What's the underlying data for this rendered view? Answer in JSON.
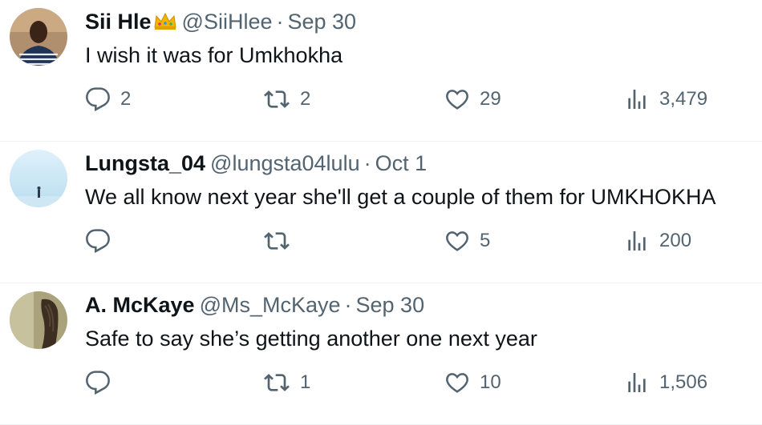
{
  "tweets": [
    {
      "name": "Sii Hle",
      "name_emoji": "crown",
      "handle": "@SiiHlee",
      "date": "Sep 30",
      "text": "I wish it was for Umkhokha",
      "replies": "2",
      "retweets": "2",
      "likes": "29",
      "views": "3,479"
    },
    {
      "name": "Lungsta_04",
      "handle": "@lungsta04lulu",
      "date": "Oct 1",
      "text": "We all know next year she'll get a couple of them for UMKHOKHA",
      "replies": "",
      "retweets": "",
      "likes": "5",
      "views": "200"
    },
    {
      "name": "A. McKaye",
      "handle": "@Ms_McKaye",
      "date": "Sep 30",
      "text": "Safe to say she’s getting another one next year",
      "replies": "",
      "retweets": "1",
      "likes": "10",
      "views": "1,506"
    }
  ],
  "icons": {
    "reply": "reply-icon",
    "retweet": "retweet-icon",
    "like": "heart-icon",
    "views": "views-icon"
  },
  "colors": {
    "text": "#0f1419",
    "muted": "#536471",
    "divider": "#eff3f4"
  }
}
